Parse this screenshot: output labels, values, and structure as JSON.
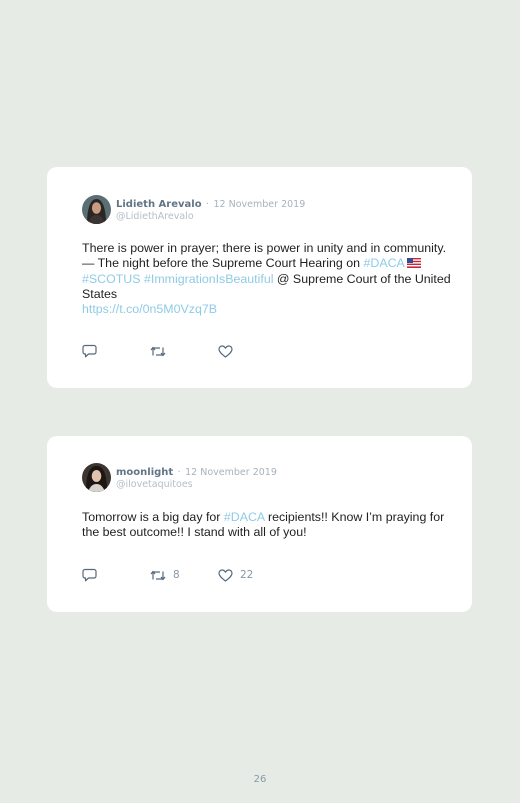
{
  "tweets": [
    {
      "name": "Lidieth Arevalo",
      "separator": "·",
      "date": "12 November 2019",
      "handle": "@LidiethArevalo",
      "text_1": "There is power in prayer; there is power in unity and in community. — The night before the Supreme Court Hearing on ",
      "tag_1": "#DACA",
      "flag_icon": "us-flag-icon",
      "tag_2": "#SCOTUS",
      "tag_3": "#ImmigrationIsBeautiful",
      "text_2": " @ Supreme Court of the United States",
      "link": "https://t.co/0n5M0Vzq7B",
      "retweets": "",
      "likes": ""
    },
    {
      "name": "moonlight",
      "separator": "·",
      "date": "12 November 2019",
      "handle": "@ilovetaquitoes",
      "text_1": "Tomorrow is a big day for ",
      "tag_1": "#DACA",
      "text_2": " recipients!! Know I’m praying for the best outcome!! I stand with all of you!",
      "retweets": "8",
      "likes": "22"
    }
  ],
  "icons": {
    "reply": "reply-icon",
    "retweet": "retweet-icon",
    "like": "heart-icon"
  },
  "colors": {
    "background": "#e6ebe5",
    "card": "#ffffff",
    "hashtag": "#8fcbe6",
    "name": "#627585"
  },
  "page_number": "26"
}
